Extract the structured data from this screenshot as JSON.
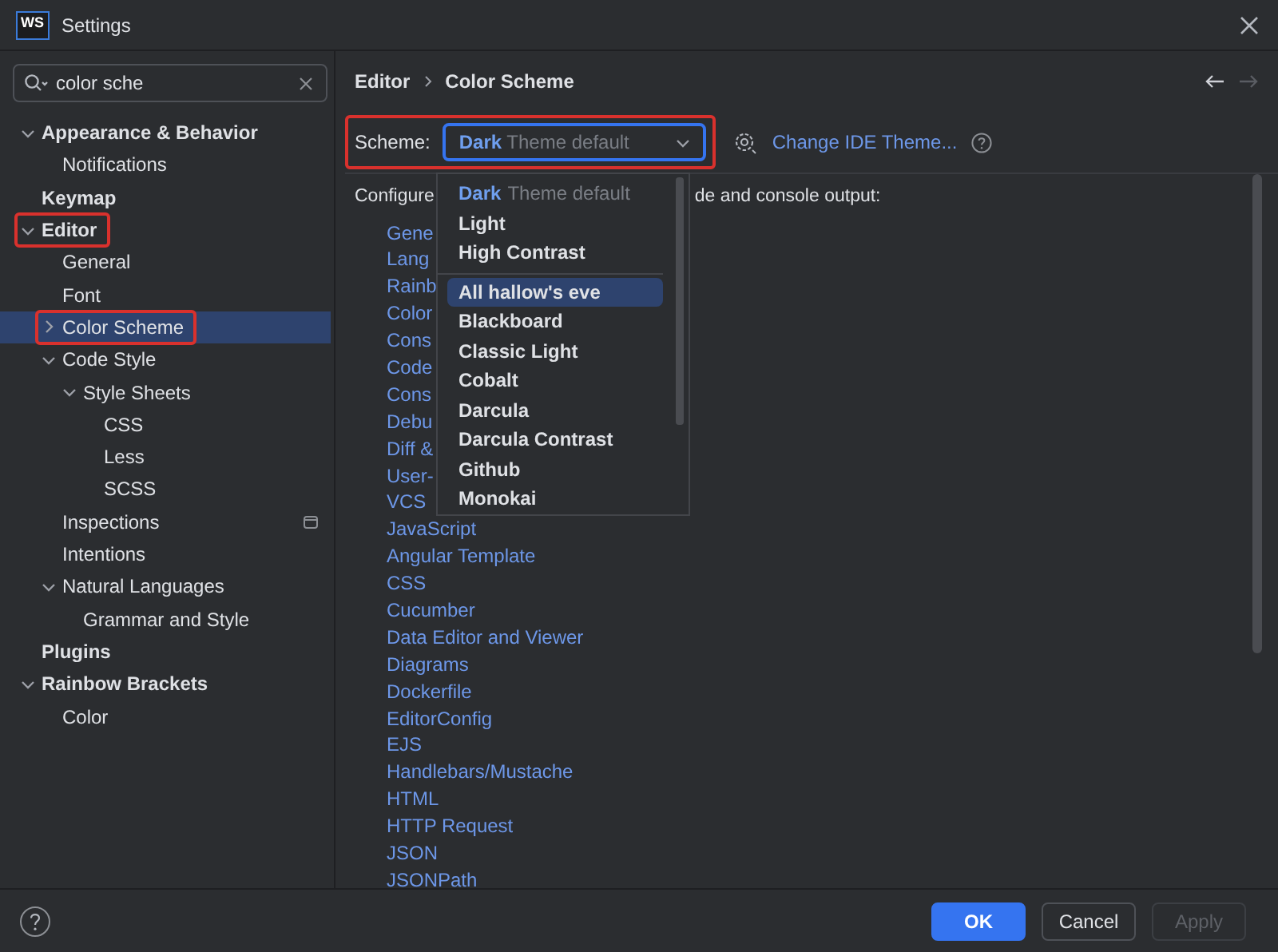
{
  "window": {
    "app_icon_text": "WS",
    "title": "Settings"
  },
  "search": {
    "value": "color sche"
  },
  "tree": [
    {
      "label": "Appearance & Behavior",
      "expanded": true,
      "children": [
        {
          "label": "Notifications",
          "selected": false
        }
      ],
      "selected": false
    },
    {
      "label": "Keymap",
      "selected": false
    },
    {
      "label": "Editor",
      "expanded": true,
      "highlighted": true,
      "selected": false,
      "children": [
        {
          "label": "General",
          "selected": false
        },
        {
          "label": "Font",
          "selected": false
        },
        {
          "label": "Color Scheme",
          "expanded": false,
          "highlighted": true,
          "selected": true
        },
        {
          "label": "Code Style",
          "expanded": true,
          "selected": false,
          "children": [
            {
              "label": "Style Sheets",
              "expanded": true,
              "selected": false,
              "children": [
                {
                  "label": "CSS",
                  "selected": false
                },
                {
                  "label": "Less",
                  "selected": false
                },
                {
                  "label": "SCSS",
                  "selected": false
                }
              ]
            }
          ]
        },
        {
          "label": "Inspections",
          "scope_icon": true,
          "selected": false
        },
        {
          "label": "Intentions",
          "selected": false
        },
        {
          "label": "Natural Languages",
          "expanded": true,
          "selected": false,
          "children": [
            {
              "label": "Grammar and Style",
              "selected": false
            }
          ]
        }
      ]
    },
    {
      "label": "Plugins",
      "selected": false
    },
    {
      "label": "Rainbow Brackets",
      "expanded": true,
      "selected": false,
      "children": [
        {
          "label": "Color",
          "selected": false
        }
      ]
    }
  ],
  "breadcrumb": [
    "Editor",
    "Color Scheme"
  ],
  "nav": {
    "back_enabled": true,
    "forward_enabled": false
  },
  "scheme": {
    "label": "Scheme:",
    "value_name": "Dark",
    "value_suffix": "Theme default",
    "highlighted": true,
    "link": "Change IDE Theme..."
  },
  "description": {
    "start": "Configure",
    "end": "de and console output:"
  },
  "links": [
    "Gene",
    "Lang",
    "Rainb",
    "Color",
    "Cons",
    "Code",
    "Cons",
    "Debu",
    "Diff &",
    "User-",
    "VCS",
    "JavaScript",
    "Angular Template",
    "CSS",
    "Cucumber",
    "Data Editor and Viewer",
    "Diagrams",
    "Dockerfile",
    "EditorConfig",
    "EJS",
    "Handlebars/Mustache",
    "HTML",
    "HTTP Request",
    "JSON",
    "JSONPath"
  ],
  "dropdown": {
    "groups": [
      [
        {
          "name": "Dark",
          "suffix": "Theme default",
          "current": true,
          "selected": false
        },
        {
          "name": "Light",
          "current": false,
          "selected": false
        },
        {
          "name": "High Contrast",
          "current": false,
          "selected": false
        }
      ],
      [
        {
          "name": "All hallow's eve",
          "current": false,
          "selected": true
        },
        {
          "name": "Blackboard",
          "current": false,
          "selected": false
        },
        {
          "name": "Classic Light",
          "current": false,
          "selected": false
        },
        {
          "name": "Cobalt",
          "current": false,
          "selected": false
        },
        {
          "name": "Darcula",
          "current": false,
          "selected": false
        },
        {
          "name": "Darcula Contrast",
          "current": false,
          "selected": false
        },
        {
          "name": "Github",
          "current": false,
          "selected": false
        },
        {
          "name": "Monokai",
          "current": false,
          "selected": false
        }
      ]
    ]
  },
  "buttons": [
    {
      "label": "OK",
      "kind": "primary",
      "disabled": false
    },
    {
      "label": "Cancel",
      "kind": "normal",
      "disabled": false
    },
    {
      "label": "Apply",
      "kind": "normal",
      "disabled": true
    }
  ]
}
